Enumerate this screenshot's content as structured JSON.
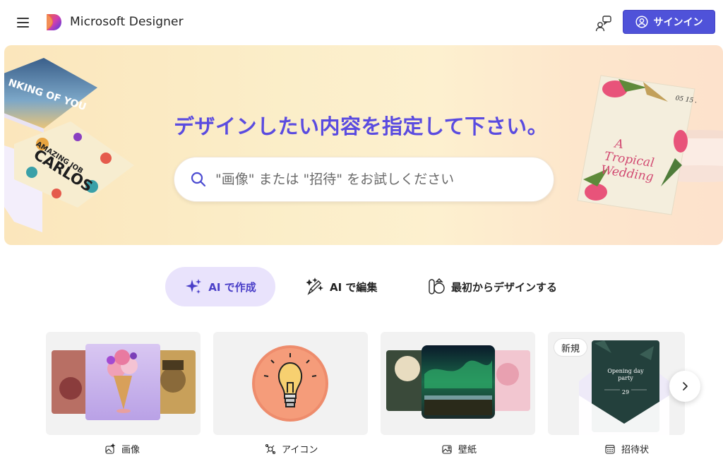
{
  "header": {
    "app_title": "Microsoft Designer",
    "signin_label": "サインイン"
  },
  "hero": {
    "title": "デザインしたい内容を指定して下さい。",
    "search_placeholder": "\"画像\" または \"招待\" をお試しください",
    "deco_card_1_text": "NKING OF YOU",
    "deco_card_2_text_top": "AMAZING JOB",
    "deco_card_2_text_main": "CARLOS",
    "deco_invite_title_1": "A",
    "deco_invite_title_2": "Tropical",
    "deco_invite_title_3": "Wedding",
    "deco_invite_date": "05 15 26"
  },
  "modes": [
    {
      "label": "AI で作成",
      "icon": "sparkle-icon",
      "active": true
    },
    {
      "label": "AI で編集",
      "icon": "magic-brush-icon",
      "active": false
    },
    {
      "label": "最初からデザインする",
      "icon": "shapes-icon",
      "active": false
    }
  ],
  "cards": [
    {
      "label": "画像",
      "icon": "image-sparkle-icon"
    },
    {
      "label": "アイコン",
      "icon": "icon-shapes-icon"
    },
    {
      "label": "壁紙",
      "icon": "wallpaper-icon"
    },
    {
      "label": "招待状",
      "icon": "calendar-icon",
      "badge": "新規",
      "card_text_1": "Opening day",
      "card_text_2": "party",
      "card_text_3": "29"
    }
  ],
  "colors": {
    "accent": "#4f52d9",
    "hero_title": "#5a4be0",
    "active_tab_bg": "#e9e3fc"
  }
}
